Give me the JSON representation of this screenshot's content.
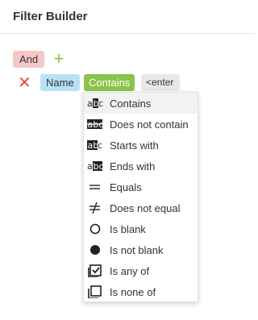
{
  "header": {
    "title": "Filter Builder"
  },
  "group": {
    "operator_label": "And",
    "add_label": "+"
  },
  "condition": {
    "remove_label": "✕",
    "field_label": "Name",
    "operation_label": "Contains",
    "value_placeholder": "<enter a value>"
  },
  "menu": {
    "items": [
      {
        "label": "Contains",
        "icon": "contains-icon"
      },
      {
        "label": "Does not contain",
        "icon": "does-not-contain-icon"
      },
      {
        "label": "Starts with",
        "icon": "starts-with-icon"
      },
      {
        "label": "Ends with",
        "icon": "ends-with-icon"
      },
      {
        "label": "Equals",
        "icon": "equals-icon"
      },
      {
        "label": "Does not equal",
        "icon": "not-equal-icon"
      },
      {
        "label": "Is blank",
        "icon": "empty-circle-icon"
      },
      {
        "label": "Is not blank",
        "icon": "filled-circle-icon"
      },
      {
        "label": "Is any of",
        "icon": "checked-box-icon"
      },
      {
        "label": "Is none of",
        "icon": "stacked-squares-icon"
      }
    ],
    "selected_index": 0
  },
  "colors": {
    "and_bg": "#f6c7c6",
    "add": "#8cc34a",
    "remove": "#e64a4a",
    "field_bg": "#b6e2f5",
    "operation_bg": "#8cc34a",
    "value_bg": "#e8e8e8"
  }
}
